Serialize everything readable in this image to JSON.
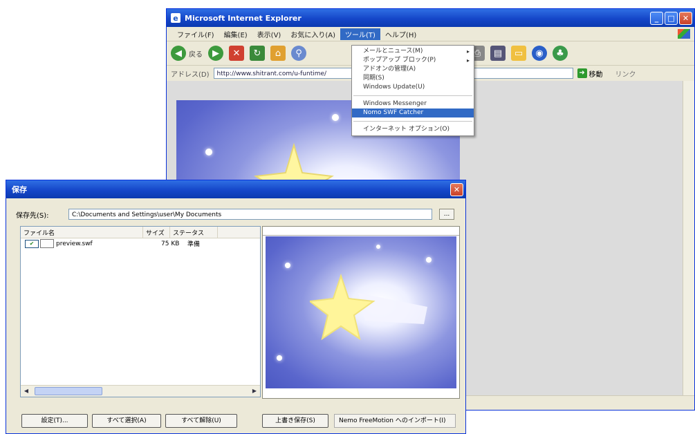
{
  "ie": {
    "title": "Microsoft Internet Explorer",
    "menu": [
      "ファイル(F)",
      "編集(E)",
      "表示(V)",
      "お気に入り(A)",
      "ツール(T)",
      "ヘルプ(H)"
    ],
    "toolbar_back": "戻る",
    "address_label": "アドレス(D)",
    "address_value": "http://www.shitrant.com/u-funtime/",
    "go_label": "移動",
    "links_label": "リンク"
  },
  "tools_menu": {
    "items": [
      {
        "label": "メールとニュース(M)",
        "submenu": true
      },
      {
        "label": "ポップアップ ブロック(P)",
        "submenu": true
      },
      {
        "label": "アドオンの管理(A)",
        "submenu": false
      },
      {
        "label": "同期(S)",
        "submenu": false
      },
      {
        "label": "Windows Update(U)",
        "submenu": false
      }
    ],
    "group2": [
      {
        "label": "Windows Messenger",
        "highlighted": false
      },
      {
        "label": "Nomo SWF Catcher",
        "highlighted": true
      }
    ],
    "group3": [
      {
        "label": "インターネット オプション(O)",
        "highlighted": false
      }
    ]
  },
  "dialog": {
    "title": "保存",
    "save_to_label": "保存先(S):",
    "save_to_path": "C:\\Documents and Settings\\user\\My Documents",
    "browse_label": "...",
    "columns": [
      "ファイル名",
      "サイズ",
      "ステータス"
    ],
    "files": [
      {
        "name": "preview.swf",
        "size": "75 KB",
        "status": "準備",
        "checked": true
      }
    ],
    "buttons": {
      "settings": "設定(T)...",
      "select_all": "すべて選択(A)",
      "deselect_all": "すべて解除(U)",
      "overwrite_save": "上書き保存(S)",
      "import": "Nemo FreeMotion へのインポート(I)"
    }
  },
  "colors": {
    "xp_title_blue": "#1546c8",
    "menu_highlight": "#316ac5",
    "window_face": "#ece9d8"
  }
}
